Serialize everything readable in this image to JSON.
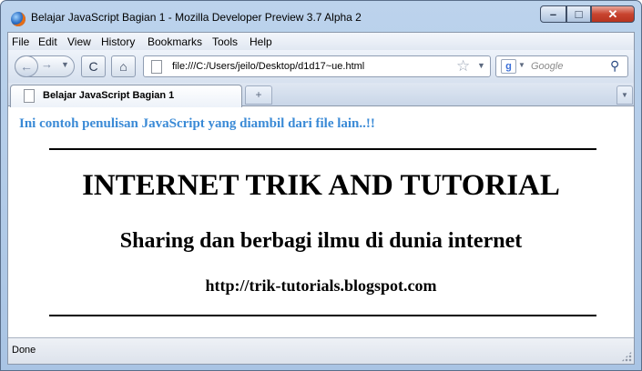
{
  "window": {
    "title": "Belajar JavaScript Bagian 1 - Mozilla Developer Preview 3.7 Alpha 2",
    "controls": {
      "minimize": "–",
      "maximize": "□",
      "close": "✕"
    }
  },
  "menubar": {
    "items": [
      {
        "label": "File"
      },
      {
        "label": "Edit"
      },
      {
        "label": "View"
      },
      {
        "label": "History"
      },
      {
        "label": "Bookmarks"
      },
      {
        "label": "Tools"
      },
      {
        "label": "Help"
      }
    ]
  },
  "navigation": {
    "back_glyph": "←",
    "forward_glyph": "→",
    "dropdown_glyph": "▼",
    "reload_glyph": "C",
    "home_glyph": "⌂",
    "url": "file:///C:/Users/jeilo/Desktop/d1d17~ue.html",
    "star_glyph": "☆",
    "search_engine_glyph": "g",
    "search_placeholder": "Google",
    "search_glyph": "⚲"
  },
  "tabs": {
    "items": [
      {
        "label": "Belajar JavaScript Bagian 1"
      }
    ],
    "new_tab_glyph": "+",
    "tab_list_glyph": "▼"
  },
  "page": {
    "intro": "Ini contoh penulisan JavaScript yang diambil dari file lain..!!",
    "heading_main": "INTERNET TRIK AND TUTORIAL",
    "heading_sub": "Sharing dan berbagi ilmu di dunia internet",
    "heading_url": "http://trik-tutorials.blogspot.com",
    "intro_color": "#3a8ad6"
  },
  "status": {
    "text": "Done"
  }
}
